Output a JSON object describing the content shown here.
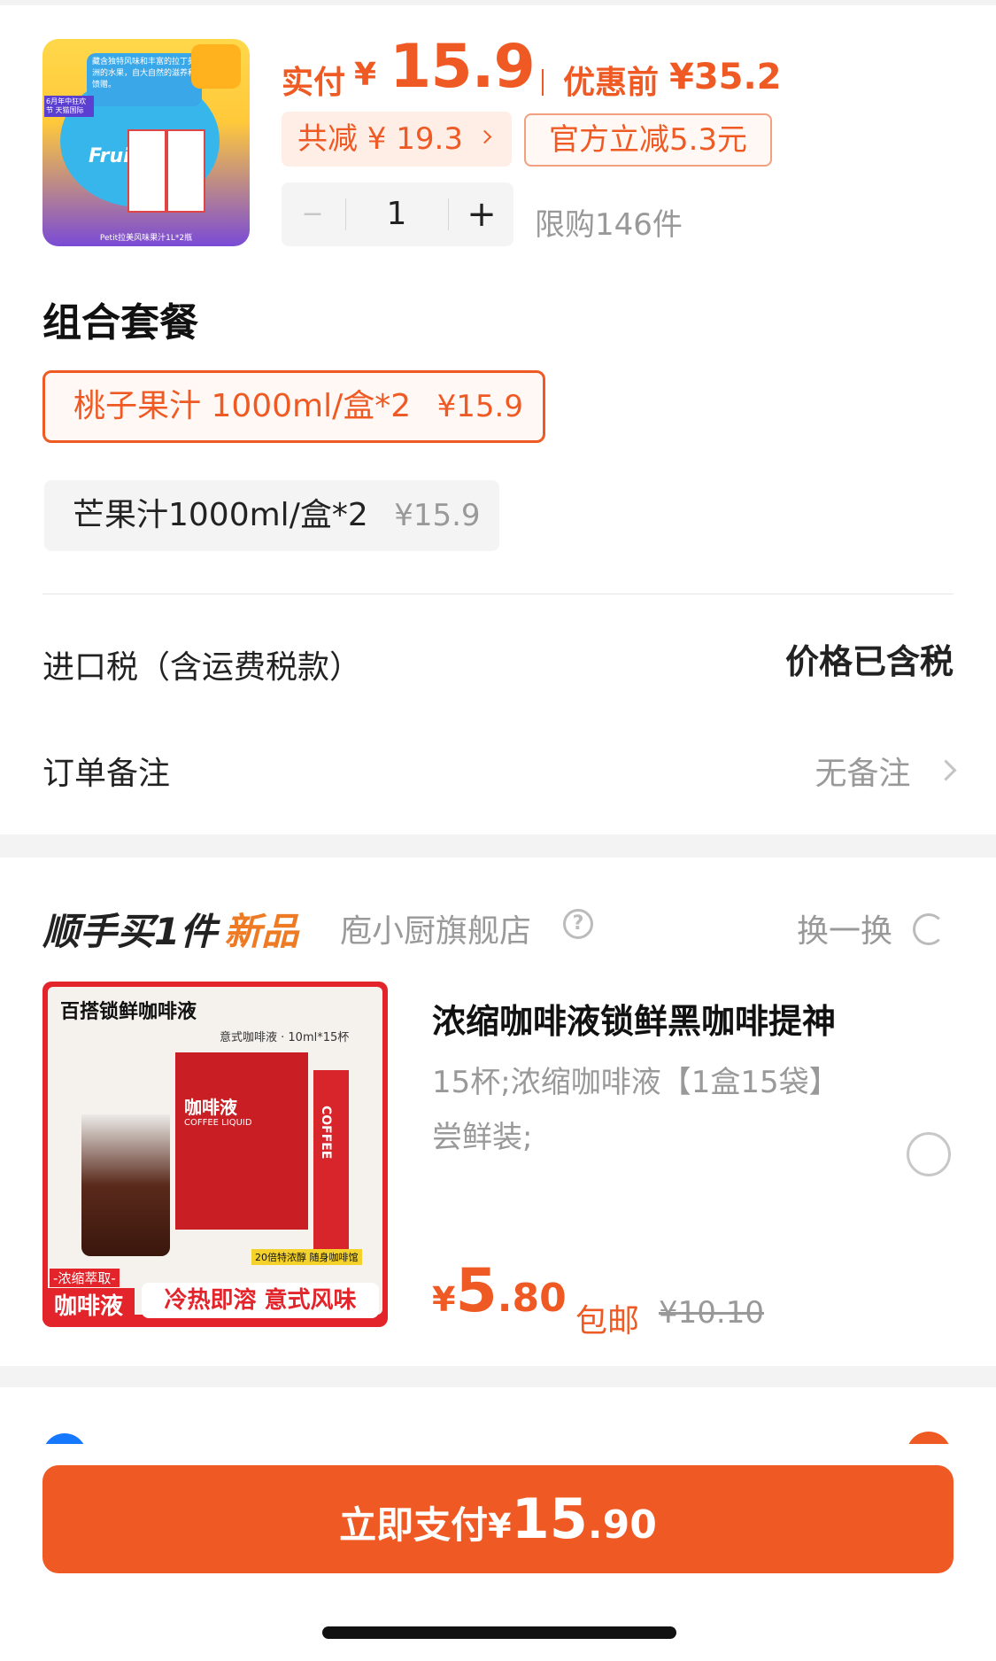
{
  "product": {
    "image_alt": "Petit果汁礼盒",
    "image_text": {
      "tagline": "藏含独特风味和丰富的拉丁美洲的水果，自大自然的滋养和馈赠。",
      "badge": "6月年中狂欢节 天猫国际",
      "brand": "Fruit",
      "caption": "Petit拉美风味果汁1L*2瓶"
    },
    "paid_label": "实付",
    "currency": "¥",
    "paid_price": "15.9",
    "before_label": "优惠前",
    "before_price": "¥35.2",
    "total_discount": "共减 ¥ 19.3",
    "official_discount": "官方立减5.3元",
    "quantity": "1",
    "minus": "−",
    "plus": "+",
    "limit": "限购146件"
  },
  "combo": {
    "title": "组合套餐",
    "options": [
      {
        "label": "桃子果汁 1000ml/盒*2",
        "price": "¥15.9",
        "selected": true
      },
      {
        "label": "芒果汁1000ml/盒*2",
        "price": "¥15.9",
        "selected": false
      }
    ]
  },
  "rows": {
    "tax_label": "进口税（含运费税款）",
    "tax_value": "价格已含税",
    "note_label": "订单备注",
    "note_value": "无备注"
  },
  "addon": {
    "title_main": "顺手买1件",
    "title_tag": "新品",
    "store": "庖小厨旗舰店",
    "swap": "换一换",
    "image_text": {
      "top": "百搭锁鲜咖啡液",
      "sub": "意式咖啡液 · 10ml*15杯",
      "box": "咖啡液",
      "box_en": "COFFEE LIQUID",
      "bottom_left_top": "-浓缩萃取-",
      "bottom_left": "咖啡液",
      "bottom_right": "冷热即溶 意式风味",
      "small": "20倍特浓醇 随身咖啡馆",
      "stick": "COFFEE"
    },
    "name": "浓缩咖啡液锁鲜黑咖啡提神",
    "spec_line1": "15杯;浓缩咖啡液【1盒15袋】",
    "spec_line2": "尝鲜装;",
    "price_currency": "¥",
    "price_int": "5",
    "price_dec": ".80",
    "shipping": "包邮",
    "original_price": "¥10.10"
  },
  "pay": {
    "label": "立即支付",
    "currency": "¥",
    "int": "15",
    "dec": ".90"
  },
  "colors": {
    "accent": "#ef5a24",
    "chip_bg": "#ffeee6",
    "gray_text": "#999999"
  }
}
